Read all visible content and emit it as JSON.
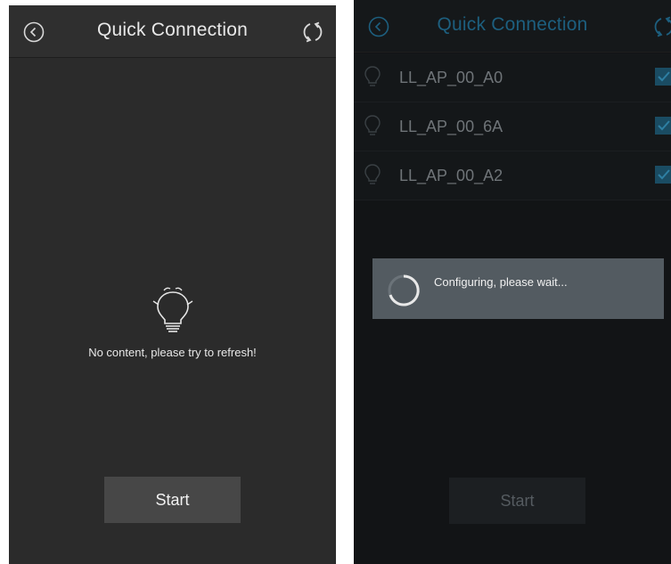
{
  "left_screen": {
    "title": "Quick Connection",
    "empty_message": "No content, please try to refresh!",
    "start_label": "Start"
  },
  "right_screen": {
    "title": "Quick Connection",
    "devices": [
      {
        "name": "LL_AP_00_A0",
        "checked": true
      },
      {
        "name": "LL_AP_00_6A",
        "checked": true
      },
      {
        "name": "LL_AP_00_A2",
        "checked": true
      }
    ],
    "dialog_message": "Configuring, please wait...",
    "start_label": "Start"
  },
  "icons": {
    "back": "back-circle-icon",
    "refresh": "refresh-icon",
    "bulb": "light-bulb-icon",
    "checkbox": "checkbox-checked-icon",
    "spinner": "loading-spinner-icon"
  },
  "colors": {
    "dark_background": "#2b2b2b",
    "dim_background": "#121416",
    "dialog": "#535b61",
    "accent_dimmed": "#1d5f7f"
  }
}
